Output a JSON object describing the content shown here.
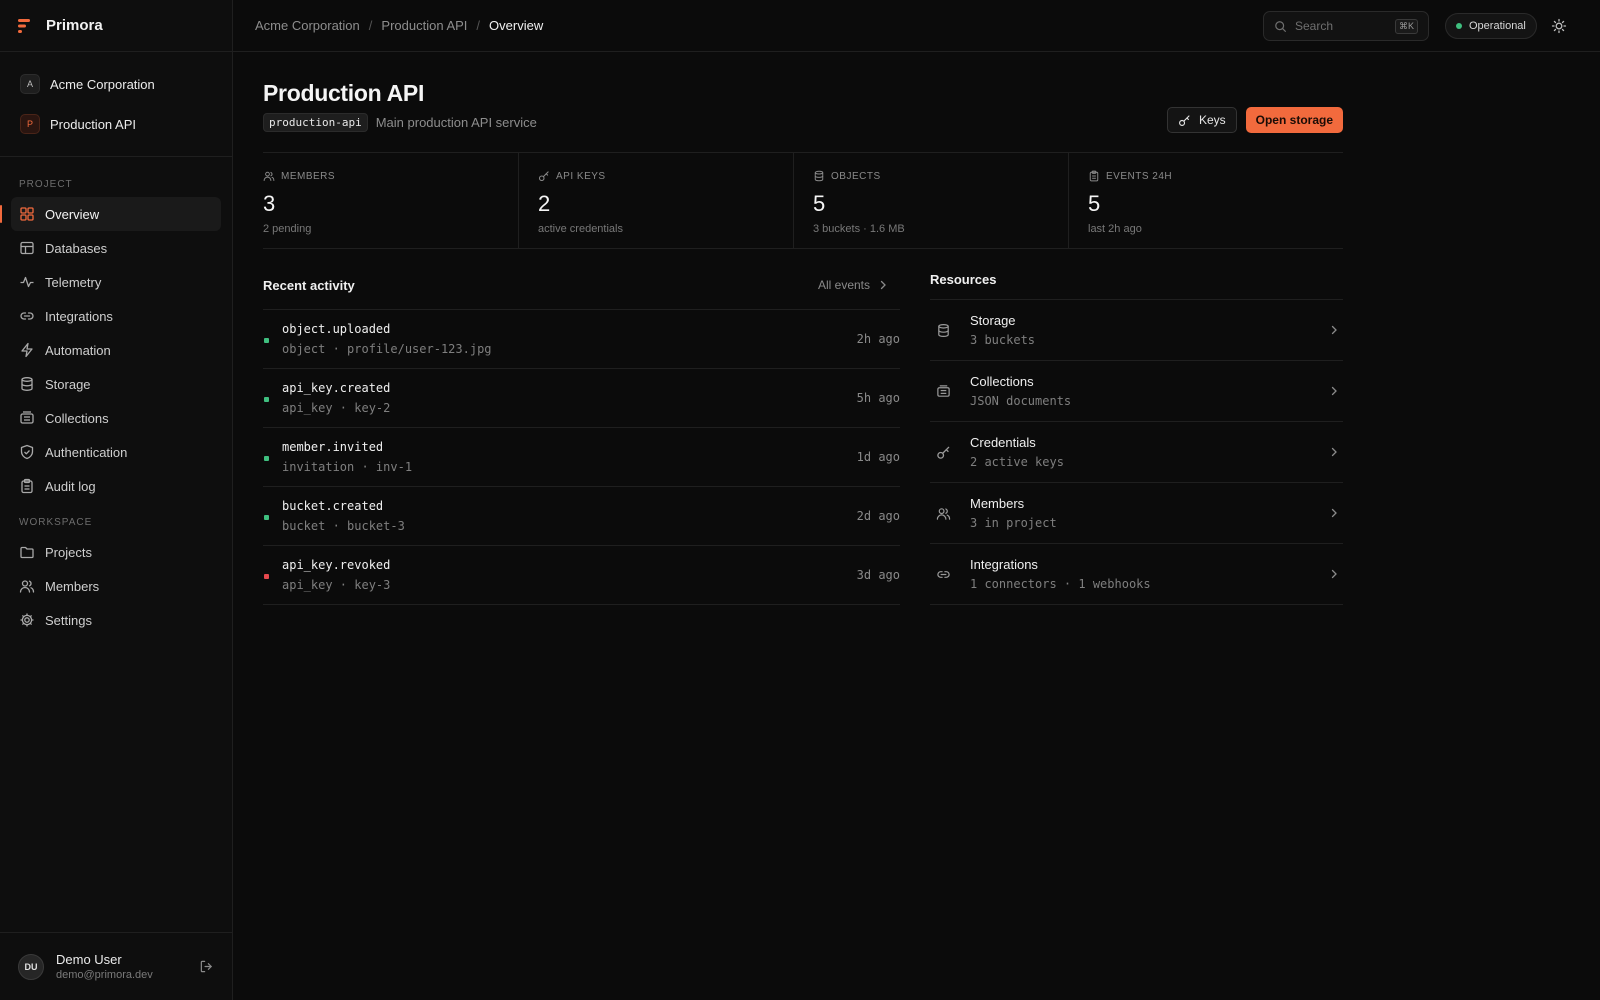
{
  "brand": {
    "name": "Primora",
    "accent": "#f26a3d"
  },
  "context": {
    "org": {
      "badge": "A",
      "name": "Acme Corporation"
    },
    "project": {
      "badge": "P",
      "name": "Production API"
    }
  },
  "sidebar": {
    "project_label": "PROJECT",
    "project_items": [
      {
        "label": "Overview",
        "icon": "grid-icon",
        "active": true
      },
      {
        "label": "Databases",
        "icon": "table-icon"
      },
      {
        "label": "Telemetry",
        "icon": "pulse-icon"
      },
      {
        "label": "Integrations",
        "icon": "link-icon"
      },
      {
        "label": "Automation",
        "icon": "bolt-icon"
      },
      {
        "label": "Storage",
        "icon": "database-icon"
      },
      {
        "label": "Collections",
        "icon": "collection-icon"
      },
      {
        "label": "Authentication",
        "icon": "shield-icon"
      },
      {
        "label": "Audit log",
        "icon": "clipboard-icon"
      }
    ],
    "workspace_label": "WORKSPACE",
    "workspace_items": [
      {
        "label": "Projects",
        "icon": "folder-icon"
      },
      {
        "label": "Members",
        "icon": "users-icon"
      },
      {
        "label": "Settings",
        "icon": "gear-icon"
      }
    ]
  },
  "user": {
    "initials": "DU",
    "name": "Demo User",
    "email": "demo@primora.dev"
  },
  "topbar": {
    "breadcrumbs": [
      "Acme Corporation",
      "Production API",
      "Overview"
    ],
    "search_placeholder": "Search",
    "search_shortcut": "⌘K",
    "status": "Operational",
    "status_color": "#3fbf7f"
  },
  "page": {
    "title": "Production API",
    "slug": "production-api",
    "description": "Main production API service",
    "keys_button": "Keys",
    "primary_button": "Open storage"
  },
  "stats": [
    {
      "label": "MEMBERS",
      "value": "3",
      "sub": "2 pending",
      "icon": "users-icon"
    },
    {
      "label": "API KEYS",
      "value": "2",
      "sub": "active credentials",
      "icon": "key-icon"
    },
    {
      "label": "OBJECTS",
      "value": "5",
      "sub": "3 buckets · 1.6 MB",
      "icon": "database-icon"
    },
    {
      "label": "EVENTS 24H",
      "value": "5",
      "sub": "last 2h ago",
      "icon": "clipboard-icon"
    }
  ],
  "activity": {
    "title": "Recent activity",
    "all_events": "All events",
    "rows": [
      {
        "event": "object.uploaded",
        "meta": "object · profile/user-123.jpg",
        "time": "2h ago",
        "status": "success"
      },
      {
        "event": "api_key.created",
        "meta": "api_key · key-2",
        "time": "5h ago",
        "status": "success"
      },
      {
        "event": "member.invited",
        "meta": "invitation · inv-1",
        "time": "1d ago",
        "status": "success"
      },
      {
        "event": "bucket.created",
        "meta": "bucket · bucket-3",
        "time": "2d ago",
        "status": "success"
      },
      {
        "event": "api_key.revoked",
        "meta": "api_key · key-3",
        "time": "3d ago",
        "status": "error"
      }
    ]
  },
  "resources": {
    "title": "Resources",
    "rows": [
      {
        "name": "Storage",
        "meta": "3 buckets",
        "icon": "database-icon"
      },
      {
        "name": "Collections",
        "meta": "JSON documents",
        "icon": "collection-icon"
      },
      {
        "name": "Credentials",
        "meta": "2 active keys",
        "icon": "key-icon"
      },
      {
        "name": "Members",
        "meta": "3 in project",
        "icon": "users-icon"
      },
      {
        "name": "Integrations",
        "meta": "1 connectors · 1 webhooks",
        "icon": "link-icon"
      }
    ]
  }
}
